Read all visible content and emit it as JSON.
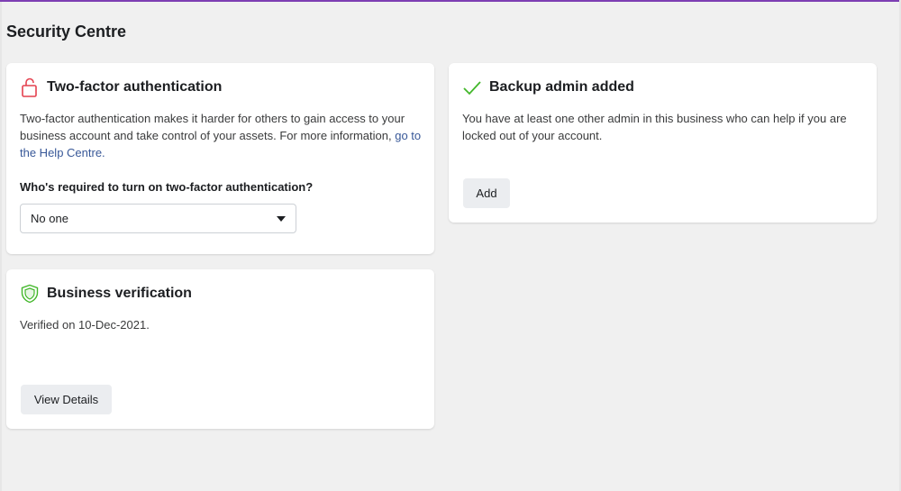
{
  "page": {
    "title": "Security Centre"
  },
  "two_factor": {
    "title": "Two-factor authentication",
    "description": "Two-factor authentication makes it harder for others to gain access to your business account and take control of your assets. For more information,",
    "link_text": "go to the Help Centre.",
    "question": "Who's required to turn on two-factor authentication?",
    "select_value": "No one",
    "icon": "unlocked-padlock-icon",
    "icon_color": "#e4404e"
  },
  "backup_admin": {
    "title": "Backup admin added",
    "description": "You have at least one other admin in this business who can help if you are locked out of your account.",
    "button_label": "Add",
    "icon": "checkmark-icon",
    "icon_color": "#42b72a"
  },
  "business_verification": {
    "title": "Business verification",
    "status": "Verified on 10-Dec-2021.",
    "button_label": "View Details",
    "icon": "shield-check-icon",
    "icon_color": "#42b72a"
  }
}
